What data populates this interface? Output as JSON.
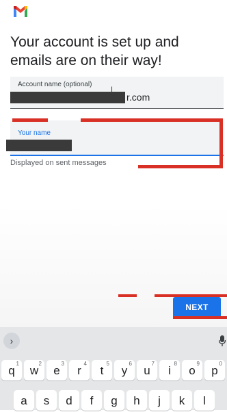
{
  "headline": "Your account is set up and emails are on their way!",
  "account_field": {
    "label": "Account name (optional)",
    "value_suffix": "r.com"
  },
  "name_field": {
    "label": "Your name",
    "helper": "Displayed on sent messages"
  },
  "next_label": "NEXT",
  "keyboard": {
    "collapse_glyph": "›",
    "row1": [
      {
        "key": "q",
        "sup": "1"
      },
      {
        "key": "w",
        "sup": "2"
      },
      {
        "key": "e",
        "sup": "3"
      },
      {
        "key": "r",
        "sup": "4"
      },
      {
        "key": "t",
        "sup": "5"
      },
      {
        "key": "y",
        "sup": "6"
      },
      {
        "key": "u",
        "sup": "7"
      },
      {
        "key": "i",
        "sup": "8"
      },
      {
        "key": "o",
        "sup": "9"
      },
      {
        "key": "p",
        "sup": "0"
      }
    ],
    "row2": [
      "a",
      "s",
      "d",
      "f",
      "g",
      "h",
      "j",
      "k",
      "l"
    ]
  },
  "colors": {
    "accent": "#1a73e8",
    "annotation": "#d93025",
    "gmail_red": "#ea4335"
  }
}
